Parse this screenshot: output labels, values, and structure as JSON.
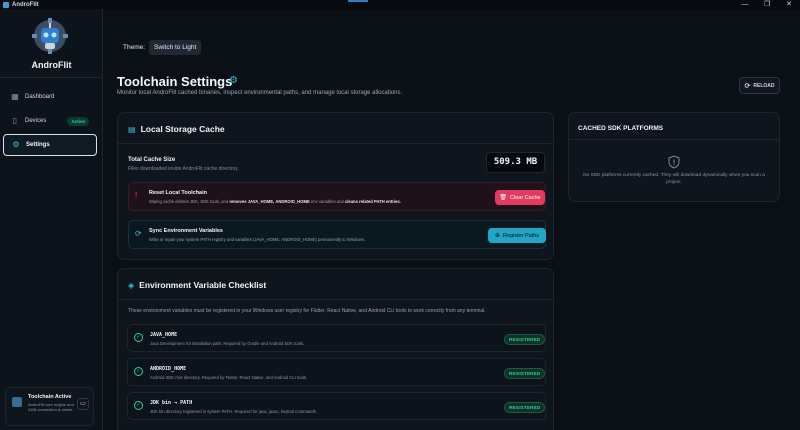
{
  "window": {
    "title": "AndroFlit",
    "controls": [
      "—",
      "❐",
      "✕"
    ]
  },
  "sidebar": {
    "brand": "AndroFlit",
    "items": [
      {
        "label": "Dashboard",
        "icon": "dashboard-icon",
        "glyph": "▦"
      },
      {
        "label": "Devices",
        "icon": "phone-icon",
        "glyph": "▯",
        "badge": "Active"
      },
      {
        "label": "Settings",
        "icon": "gear-icon",
        "glyph": "⚙"
      }
    ],
    "status": {
      "title": "Toolchain Active",
      "description": "AndroFlit core engine and ADB connection is online.",
      "folder_icon": "▭"
    }
  },
  "theme": {
    "label": "Theme:",
    "button": "Switch to Light"
  },
  "header": {
    "title": "Toolchain Settings",
    "title_icon": "⚙",
    "subtitle": "Monitor local AndroFlit cached binaries, inspect environmental paths, and manage local storage allocations.",
    "reload": "RELOAD",
    "reload_icon": "⟳"
  },
  "storage": {
    "title": "Local Storage Cache",
    "icon": "▤",
    "cache_label": "Total Cache Size",
    "cache_desc": "Files downloaded inside AndroFlit cache directory.",
    "cache_value": "509.3 MB",
    "reset": {
      "title": "Reset Local Toolchain",
      "desc_pre": "Wiping cache deletes JDK, SDK tools, and ",
      "desc_bold1": "removes JAVA_HOME, ANDROID_HOME",
      "desc_mid": " env variables and ",
      "desc_bold2": "cleans related PATH entries.",
      "button": "Clear Cache",
      "icon": "!"
    },
    "sync": {
      "title": "Sync Environment Variables",
      "desc": "Write or repair your system PATH registry and variables (JAVA_HOME, ANDROID_HOME) permanently to Windows.",
      "button": "Register Paths",
      "icon": "⟳"
    }
  },
  "env": {
    "title": "Environment Variable Checklist",
    "icon": "◈",
    "intro": "These environment variables must be registered in your Windows user registry for Flutter, React Native, and Android CLI tools to work correctly from any terminal.",
    "rows": [
      {
        "name": "JAVA_HOME",
        "desc": "Java Development Kit installation path. Required by Gradle and Android SDK tools.",
        "status": "REGISTERED"
      },
      {
        "name": "ANDROID_HOME",
        "desc": "Android SDK root directory. Required by Flutter, React Native, and Android CLI tools.",
        "status": "REGISTERED"
      },
      {
        "name": "JDK bin → PATH",
        "desc": "JDK bin directory registered in system PATH. Required for java, javac, keytool commands.",
        "status": "REGISTERED"
      }
    ]
  },
  "sdk": {
    "title": "CACHED SDK PLATFORMS",
    "empty": "No SDK platforms currently cached. They will download dynamically when you scan a project.",
    "icon": "!"
  },
  "colors": {
    "accent": "#39c2d6",
    "danger": "#e23b60",
    "success": "#2ed29c",
    "background": "#0b1017"
  }
}
